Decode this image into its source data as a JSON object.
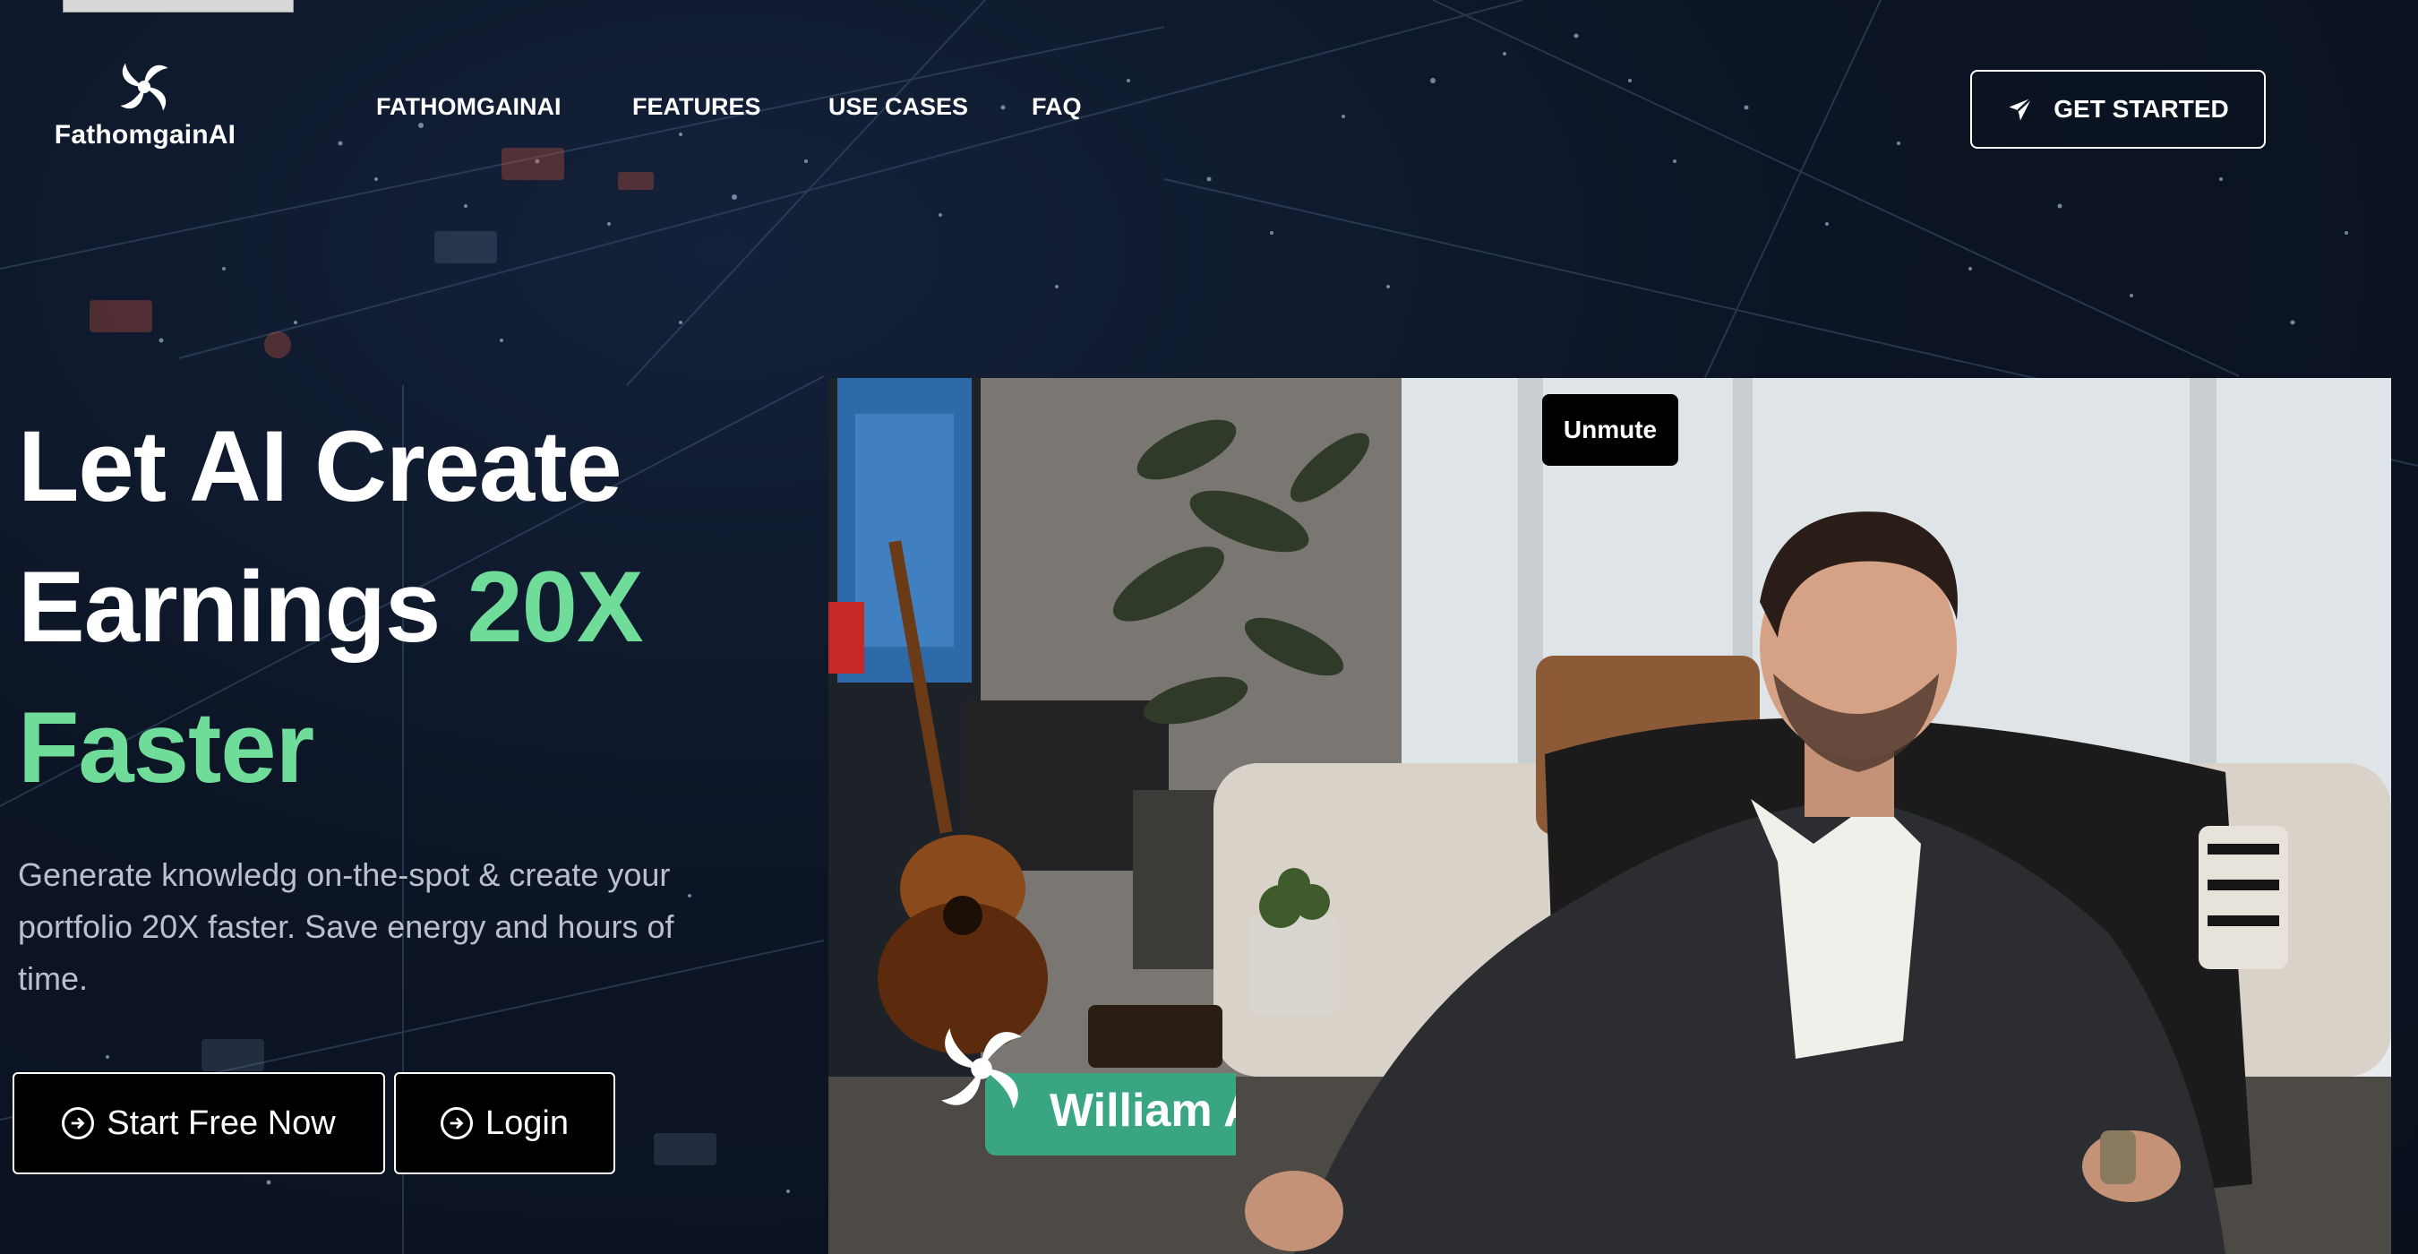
{
  "header": {
    "brand": "FathomgainAI",
    "nav": [
      "FATHOMGAINAI",
      "FEATURES",
      "USE CASES",
      "FAQ"
    ],
    "cta": "GET STARTED"
  },
  "hero": {
    "title_line1": "Let AI Create",
    "title_line2_plain": "Earnings ",
    "title_line2_accent": "20X",
    "title_line3_accent": "Faster",
    "subtitle": "Generate knowledg on-the-spot & create your portfolio 20X faster. Save energy and hours of time.",
    "primary_button": "Start Free Now",
    "secondary_button": "Login"
  },
  "video": {
    "unmute_label": "Unmute",
    "lower_third_name": "William A"
  },
  "colors": {
    "background": "#0c1525",
    "accent": "#6fdc99",
    "lower_third": "#3aa583"
  },
  "icons": {
    "logo": "pinwheel-logo-icon",
    "cta": "send-paper-plane-icon",
    "buttons": "arrow-circle-right-icon"
  }
}
